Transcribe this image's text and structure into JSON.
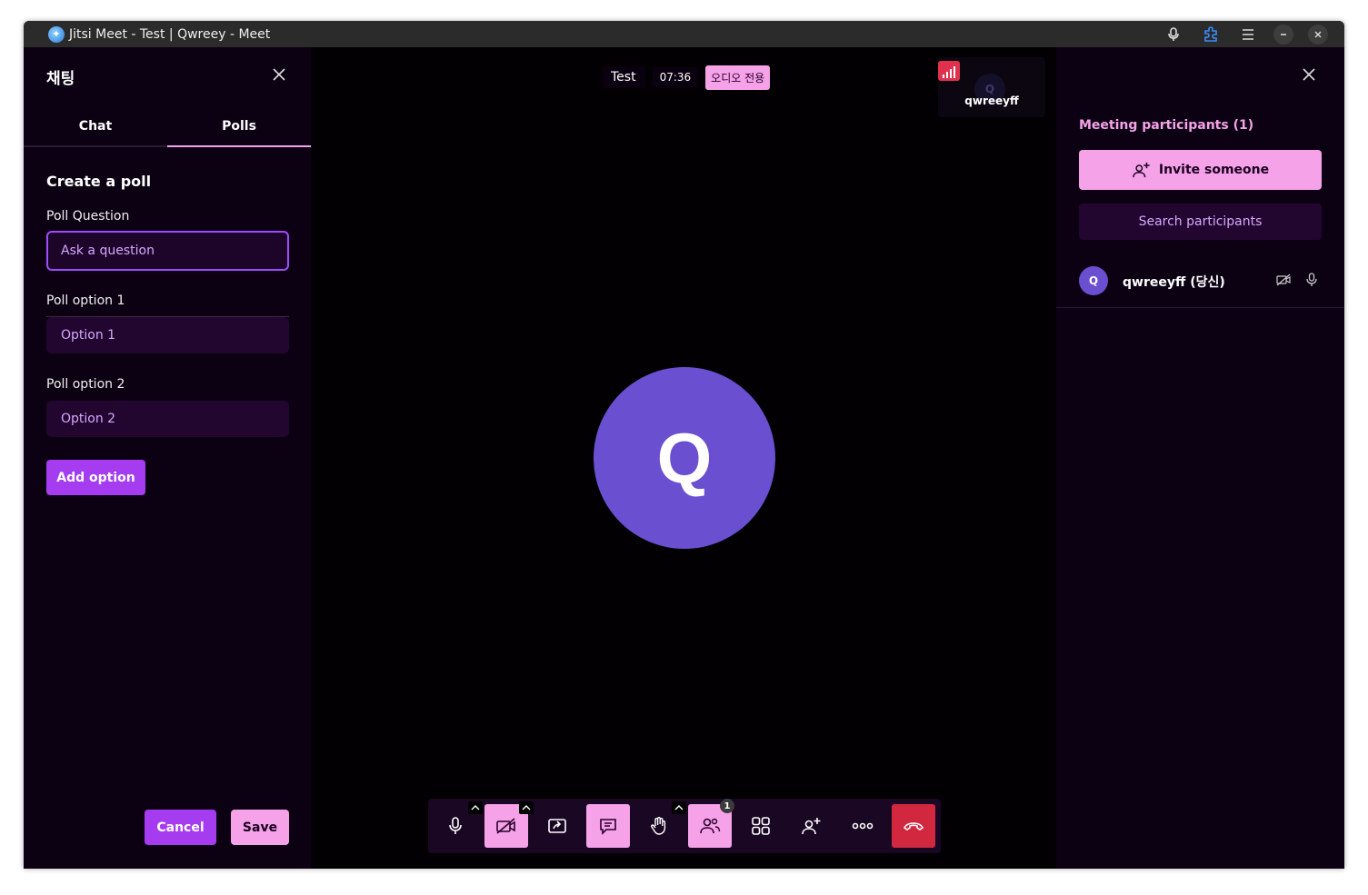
{
  "window": {
    "title": "Jitsi Meet - Test | Qwreey - Meet"
  },
  "chat_panel": {
    "title": "채팅",
    "tabs": [
      {
        "label": "Chat",
        "active": false
      },
      {
        "label": "Polls",
        "active": true
      }
    ],
    "create_poll": {
      "heading": "Create a poll",
      "question_label": "Poll Question",
      "question_placeholder": "Ask a question",
      "options": [
        {
          "label": "Poll option 1",
          "placeholder": "Option 1"
        },
        {
          "label": "Poll option 2",
          "placeholder": "Option 2"
        }
      ],
      "add_option_label": "Add option",
      "cancel_label": "Cancel",
      "save_label": "Save"
    }
  },
  "stage": {
    "meeting_name": "Test",
    "timer": "07:36",
    "audio_only_badge": "오디오 전용",
    "thumbnail": {
      "name": "qwreeyff",
      "initial": "Q"
    },
    "main_avatar_initial": "Q",
    "toolbar": {
      "icons": [
        "microphone-icon",
        "camera-off-icon",
        "share-screen-icon",
        "chat-icon",
        "raise-hand-icon",
        "participants-icon",
        "tile-view-icon",
        "invite-icon",
        "more-icon",
        "hangup-icon"
      ],
      "participants_count": "1"
    }
  },
  "participants_panel": {
    "title": "Meeting participants (1)",
    "invite_label": "Invite someone",
    "search_placeholder": "Search participants",
    "list": [
      {
        "initial": "Q",
        "name": "qwreeyff (당신)"
      }
    ]
  },
  "colors": {
    "accent_pink": "#f5a2e8",
    "accent_purple": "#a53cf0",
    "avatar": "#6a4fd0",
    "hangup": "#d2283f"
  }
}
